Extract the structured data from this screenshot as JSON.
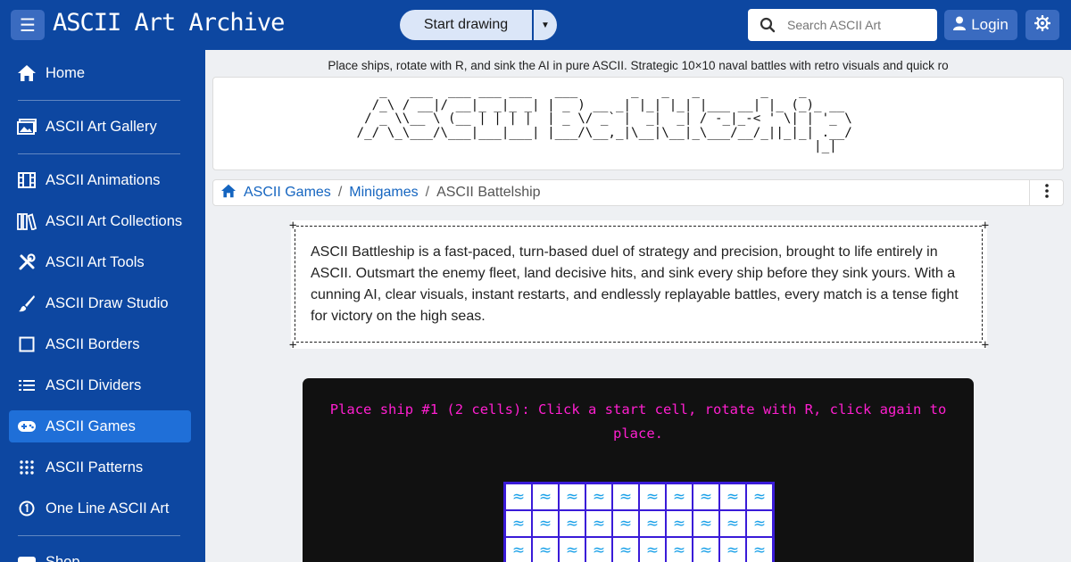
{
  "header": {
    "brand": "ASCII Art Archive",
    "start_drawing": "Start drawing",
    "search_placeholder": "Search ASCII Art",
    "login": "Login"
  },
  "sidebar": {
    "items": [
      {
        "label": "Home",
        "icon": "home-icon"
      },
      {
        "label": "ASCII Art Gallery",
        "icon": "gallery-icon"
      },
      {
        "label": "ASCII Animations",
        "icon": "film-icon"
      },
      {
        "label": "ASCII Art Collections",
        "icon": "books-icon"
      },
      {
        "label": "ASCII Art Tools",
        "icon": "tools-icon"
      },
      {
        "label": "ASCII Draw Studio",
        "icon": "brush-icon"
      },
      {
        "label": "ASCII Borders",
        "icon": "square-icon"
      },
      {
        "label": "ASCII Dividers",
        "icon": "dividers-icon"
      },
      {
        "label": "ASCII Games",
        "icon": "gamepad-icon",
        "active": true
      },
      {
        "label": "ASCII Patterns",
        "icon": "dots-grid-icon"
      },
      {
        "label": "One Line ASCII Art",
        "icon": "circle-one-icon"
      },
      {
        "label": "Shop",
        "icon": "shop-icon"
      }
    ]
  },
  "page": {
    "tagline": "Place ships, rotate with R, and sink the AI in pure ASCII. Strategic 10×10 naval battles with retro visuals and quick ro",
    "banner_art": "    _   ___  ___ ___ ___   ___       _   _   _        _    _\n   /_\\ / __|/ __|_ _|_ _| | _ ) __ _| |_| |_| |___ __| |_ (_)_ __\n  / _ \\\\__ \\ (__ | | | |  | _ \\/ _` |  _|  _| / -_|_-< ' \\| | '_ \\\n /_/ \\_\\___/\\___|___|___| |___/\\__,_|\\__|\\__|_\\___/__/_||_|_| .__/\n                                                             |_|",
    "breadcrumbs": [
      "ASCII Games",
      "Minigames",
      "ASCII Battelship"
    ],
    "description": "ASCII Battleship is a fast-paced, turn-based duel of strategy and precision, brought to life entirely in ASCII. Outsmart the enemy fleet, land decisive hits, and sink every ship before they sink yours. With a cunning AI, clear visuals, instant restarts, and endlessly replayable battles, every match is a tense fight for victory on the high seas."
  },
  "game": {
    "prompt": "Place ship #1 (2 cells): Click a start cell, rotate with R, click again to place.",
    "water_symbol": "≈",
    "columns": 10,
    "visible_rows": 3
  },
  "colors": {
    "primary": "#0d47a1",
    "active_item": "#1f6fd8",
    "prompt": "#ff1fd0",
    "grid_border": "#3a1bd8",
    "water": "#19a0e8"
  }
}
